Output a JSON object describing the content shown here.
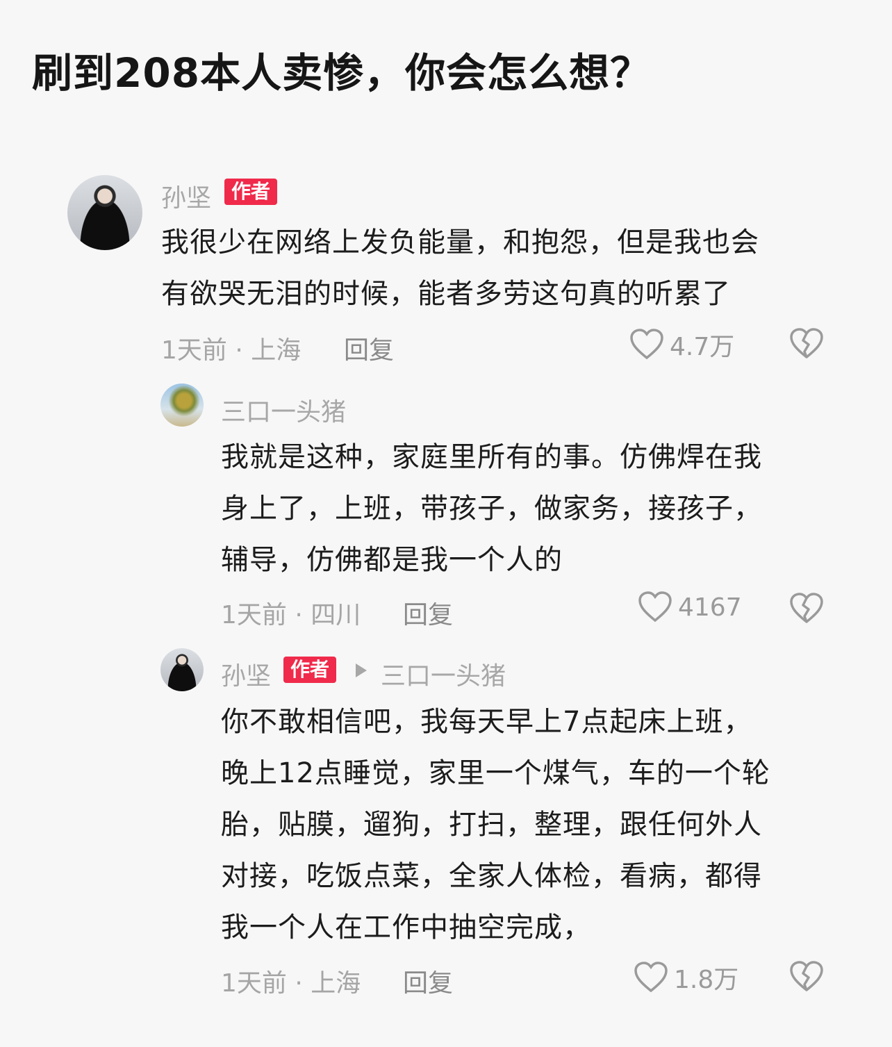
{
  "title": "刷到208本人卖惨，你会怎么想？",
  "comments": [
    {
      "username": "孙坚",
      "badge": "作者",
      "lines": [
        "我很少在网络上发负能量，和抱怨，但是我也会",
        "有欲哭无泪的时候，能者多劳这句真的听累了"
      ],
      "meta": "1天前 · 上海",
      "reply_label": "回复",
      "likes": "4.7万",
      "avatar_icon": "person-avatar-icon"
    },
    {
      "username": "三口一头猪",
      "lines": [
        "我就是这种，家庭里所有的事。仿佛焊在我",
        "身上了，上班，带孩子，做家务，接孩子，",
        "辅导，仿佛都是我一个人的"
      ],
      "meta": "1天前 · 四川",
      "reply_label": "回复",
      "likes": "4167",
      "avatar_icon": "tree-avatar-icon"
    },
    {
      "username": "孙坚",
      "badge": "作者",
      "reply_to": "三口一头猪",
      "lines": [
        "你不敢相信吧，我每天早上7点起床上班，",
        "晚上12点睡觉，家里一个煤气，车的一个轮",
        "胎，贴膜，遛狗，打扫，整理，跟任何外人",
        "对接，吃饭点菜，全家人体检，看病，都得",
        "我一个人在工作中抽空完成，"
      ],
      "meta": "1天前 · 上海",
      "reply_label": "回复",
      "likes": "1.8万",
      "avatar_icon": "person-avatar-icon"
    }
  ],
  "icons": {
    "like": "heart-icon",
    "dislike": "broken-heart-icon"
  },
  "colors": {
    "badge": "#f02a4b",
    "muted": "#a7a7a7",
    "text": "#1c1c1c",
    "background": "#f7f7f7"
  }
}
